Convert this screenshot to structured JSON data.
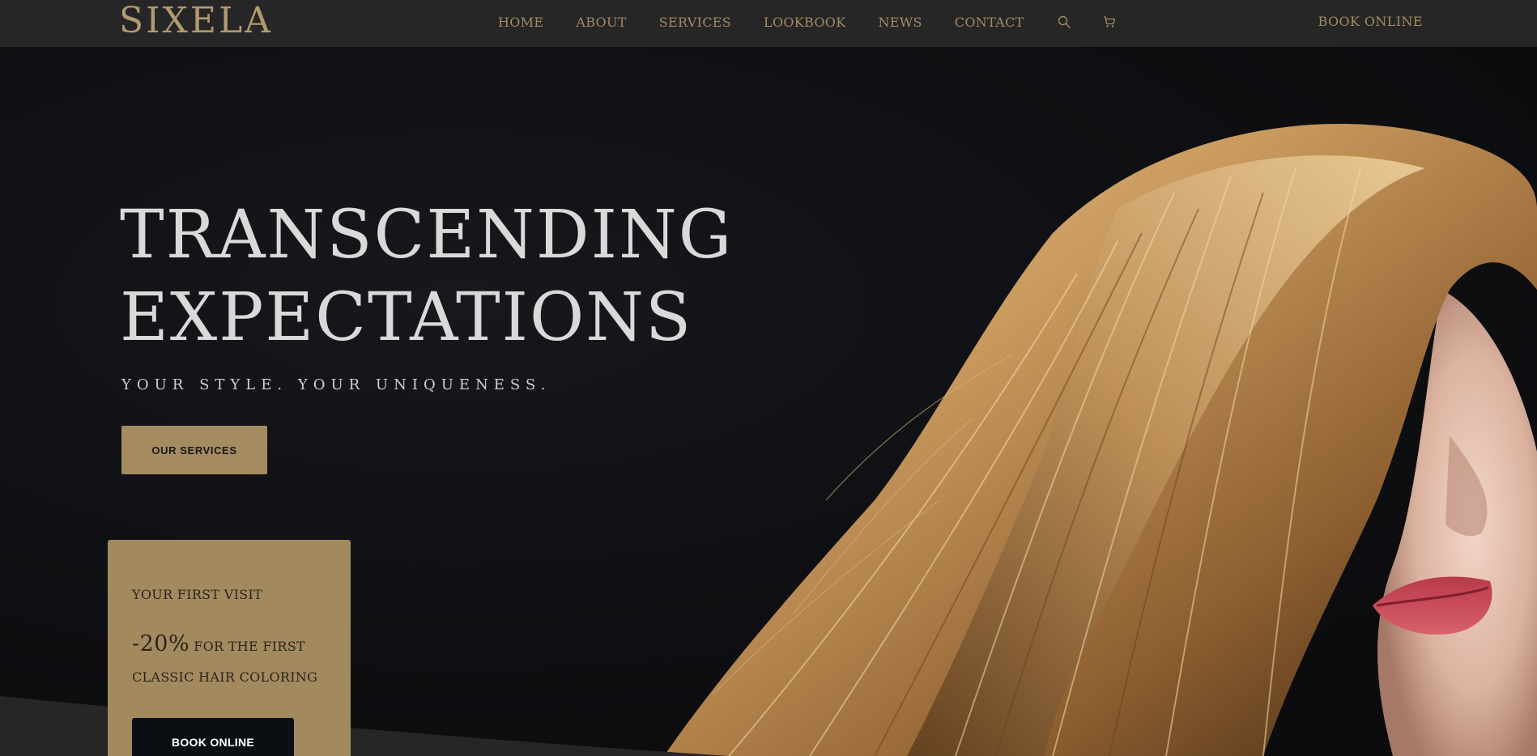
{
  "header": {
    "logo": "SIXELA",
    "nav": [
      {
        "label": "HOME"
      },
      {
        "label": "ABOUT"
      },
      {
        "label": "SERVICES"
      },
      {
        "label": "LOOKBOOK"
      },
      {
        "label": "NEWS"
      },
      {
        "label": "CONTACT"
      }
    ],
    "icons": [
      "search-icon",
      "cart-icon"
    ],
    "book_label": "BOOK ONLINE"
  },
  "hero": {
    "title_line1": "TRANSCENDING",
    "title_line2": "EXPECTATIONS",
    "subtitle": "YOUR STYLE. YOUR UNIQUENESS.",
    "cta_label": "OUR SERVICES"
  },
  "promo": {
    "title": "YOUR FIRST VISIT",
    "percent": "-20%",
    "text": "FOR THE FIRST CLASSIC HAIR COLORING",
    "button_label": "BOOK ONLINE"
  },
  "colors": {
    "header_bg": "#262626",
    "accent_gold": "#a38a62",
    "card_gold": "#a38a5e",
    "hero_bg": "#0d0d0f",
    "dark_button": "#0b0f14"
  }
}
